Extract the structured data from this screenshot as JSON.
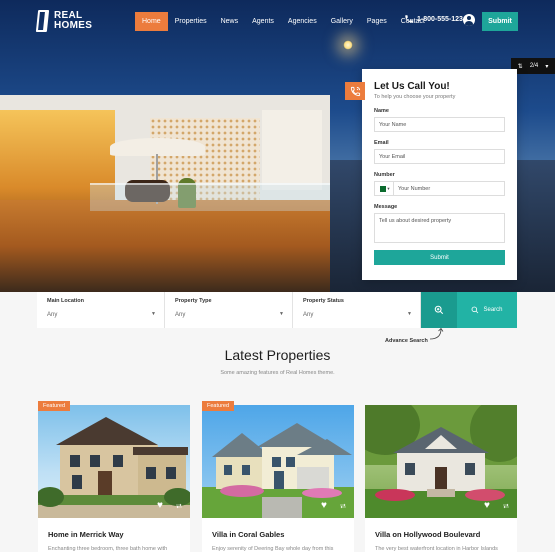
{
  "brand": {
    "line1": "REAL",
    "line2": "HOMES"
  },
  "nav": {
    "items": [
      "Home",
      "Properties",
      "News",
      "Agents",
      "Agencies",
      "Gallery",
      "Pages",
      "Contact"
    ],
    "phone": "1-800-555-1234",
    "submit_label": "Submit"
  },
  "slider": {
    "counter": "2/4"
  },
  "call_form": {
    "title": "Let Us Call You!",
    "subtitle": "To help you choose your property",
    "name_label": "Name",
    "name_placeholder": "Your Name",
    "email_label": "Email",
    "email_placeholder": "Your Email",
    "number_label": "Number",
    "number_placeholder": "Your Number",
    "message_label": "Message",
    "message_placeholder": "Tell us about desired property",
    "submit_label": "Submit"
  },
  "search": {
    "fields": [
      {
        "label": "Main Location",
        "value": "Any"
      },
      {
        "label": "Property Type",
        "value": "Any"
      },
      {
        "label": "Property Status",
        "value": "Any"
      }
    ],
    "search_label": "Search",
    "advance_label": "Advance Search"
  },
  "latest": {
    "title": "Latest Properties",
    "subtitle": "Some amazing features of Real Homes theme.",
    "cards": [
      {
        "badge": "Featured",
        "title": "Home in Merrick Way",
        "desc": "Enchanting three bedroom, three bath home with"
      },
      {
        "badge": "Featured",
        "title": "Villa in Coral Gables",
        "desc": "Enjoy serenity of Deering Bay whole day from this"
      },
      {
        "badge": "",
        "title": "Villa on Hollywood Boulevard",
        "desc": "The very best waterfront location in Harbor Islands"
      }
    ]
  },
  "colors": {
    "accent": "#ec7c3d",
    "teal": "#1ea69a",
    "navy": "#0f2e5d"
  }
}
